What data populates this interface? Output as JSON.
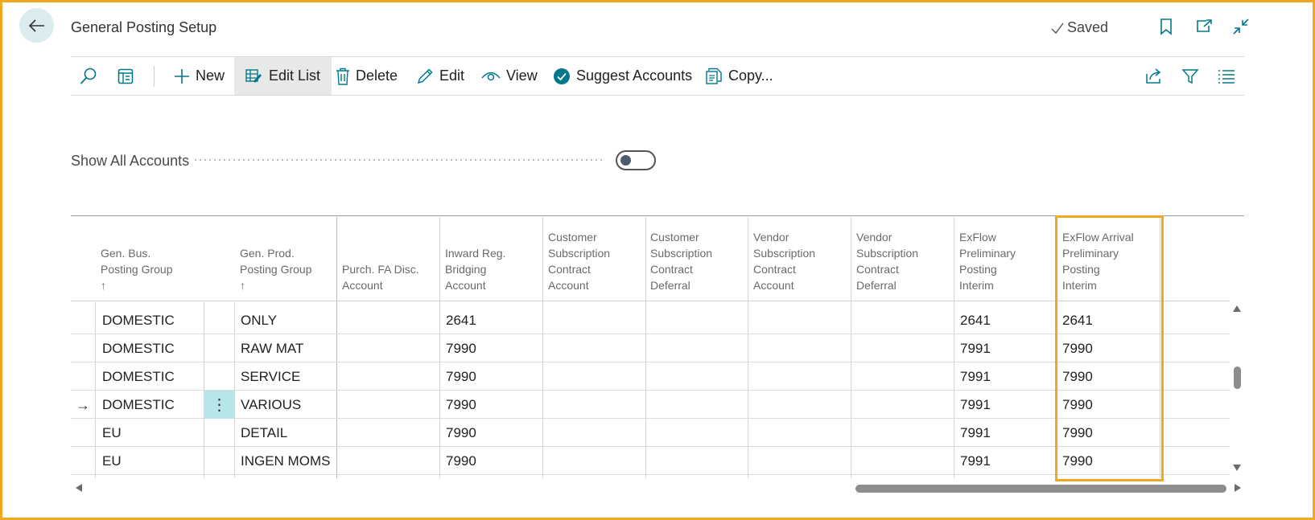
{
  "header": {
    "title": "General Posting Setup",
    "saved_label": "Saved",
    "icons": [
      "back-arrow-icon",
      "bookmark-icon",
      "open-new-window-icon",
      "collapse-icon"
    ]
  },
  "actions": {
    "new": "New",
    "edit_list": "Edit List",
    "delete": "Delete",
    "edit": "Edit",
    "view": "View",
    "suggest_accounts": "Suggest Accounts",
    "copy": "Copy..."
  },
  "filter": {
    "show_all_label": "Show All Accounts",
    "show_all_on": false
  },
  "table": {
    "columns": [
      {
        "lines": [
          "Gen. Bus.",
          "Posting Group"
        ],
        "sort": "↑"
      },
      {
        "lines": [
          "Gen. Prod.",
          "Posting Group"
        ],
        "sort": "↑"
      },
      {
        "lines": [
          "Purch. FA Disc.",
          "Account"
        ]
      },
      {
        "lines": [
          "Inward Reg.",
          "Bridging",
          "Account"
        ]
      },
      {
        "lines": [
          "Customer",
          "Subscription",
          "Contract",
          "Account"
        ]
      },
      {
        "lines": [
          "Customer",
          "Subscription",
          "Contract",
          "Deferral"
        ]
      },
      {
        "lines": [
          "Vendor",
          "Subscription",
          "Contract",
          "Account"
        ]
      },
      {
        "lines": [
          "Vendor",
          "Subscription",
          "Contract",
          "Deferral"
        ]
      },
      {
        "lines": [
          "ExFlow",
          "Preliminary",
          "Posting",
          "Interim"
        ]
      },
      {
        "lines": [
          "ExFlow Arrival",
          "Preliminary",
          "Posting",
          "Interim"
        ]
      }
    ],
    "rows": [
      {
        "bus": "DOMESTIC",
        "prod": "ONLY",
        "purch_fa": "",
        "inward": "2641",
        "cust_acc": "",
        "cust_def": "",
        "vend_acc": "",
        "vend_def": "",
        "exflow": "2641",
        "exflow_arrival": "2641",
        "current": false
      },
      {
        "bus": "DOMESTIC",
        "prod": "RAW MAT",
        "purch_fa": "",
        "inward": "7990",
        "cust_acc": "",
        "cust_def": "",
        "vend_acc": "",
        "vend_def": "",
        "exflow": "7991",
        "exflow_arrival": "7990",
        "current": false
      },
      {
        "bus": "DOMESTIC",
        "prod": "SERVICE",
        "purch_fa": "",
        "inward": "7990",
        "cust_acc": "",
        "cust_def": "",
        "vend_acc": "",
        "vend_def": "",
        "exflow": "7991",
        "exflow_arrival": "7990",
        "current": false
      },
      {
        "bus": "DOMESTIC",
        "prod": "VARIOUS",
        "purch_fa": "",
        "inward": "7990",
        "cust_acc": "",
        "cust_def": "",
        "vend_acc": "",
        "vend_def": "",
        "exflow": "7991",
        "exflow_arrival": "7990",
        "current": true
      },
      {
        "bus": "EU",
        "prod": "DETAIL",
        "purch_fa": "",
        "inward": "7990",
        "cust_acc": "",
        "cust_def": "",
        "vend_acc": "",
        "vend_def": "",
        "exflow": "7991",
        "exflow_arrival": "7990",
        "current": false
      },
      {
        "bus": "EU",
        "prod": "INGEN MOMS",
        "purch_fa": "",
        "inward": "7990",
        "cust_acc": "",
        "cust_def": "",
        "vend_acc": "",
        "vend_def": "",
        "exflow": "7991",
        "exflow_arrival": "7990",
        "current": false
      }
    ]
  },
  "colors": {
    "accent": "#f0a81e",
    "teal": "#00788c",
    "back_button_bg": "#dcecee",
    "row_menu_bg": "#b7e6ea"
  }
}
